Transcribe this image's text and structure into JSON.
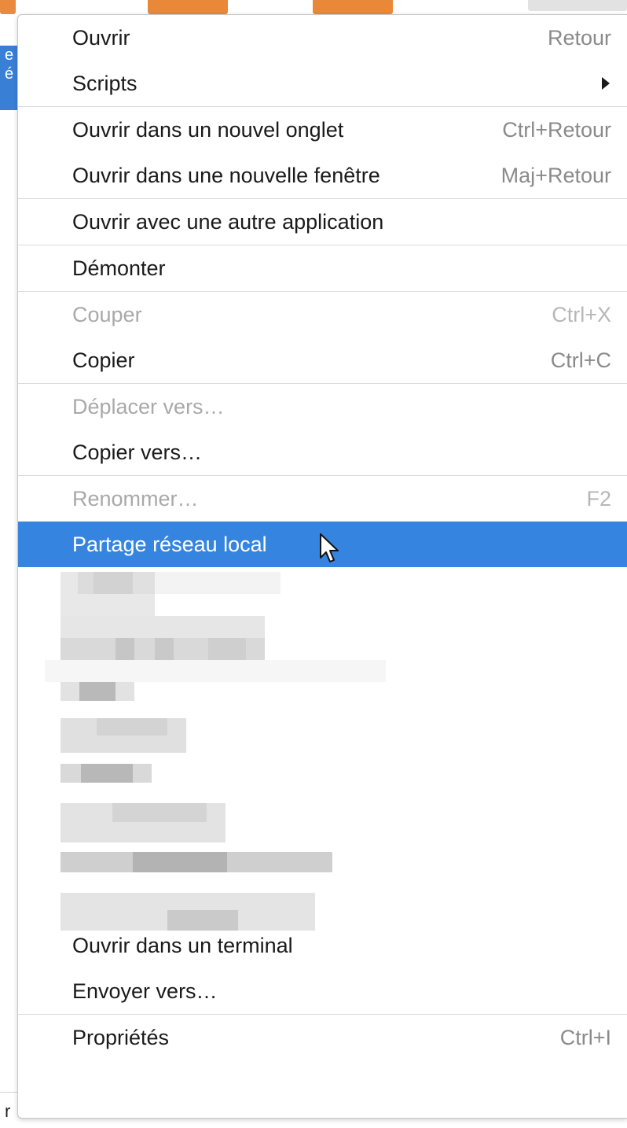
{
  "menu": {
    "sections": [
      {
        "items": [
          {
            "label": "Ouvrir",
            "shortcut": "Retour"
          },
          {
            "label": "Scripts",
            "submenu": true
          }
        ]
      },
      {
        "items": [
          {
            "label": "Ouvrir dans un nouvel onglet",
            "shortcut": "Ctrl+Retour"
          },
          {
            "label": "Ouvrir dans une nouvelle fenêtre",
            "shortcut": "Maj+Retour"
          }
        ]
      },
      {
        "items": [
          {
            "label": "Ouvrir avec une autre application"
          }
        ]
      },
      {
        "items": [
          {
            "label": "Démonter"
          }
        ]
      },
      {
        "items": [
          {
            "label": "Couper",
            "shortcut": "Ctrl+X",
            "disabled": true
          },
          {
            "label": "Copier",
            "shortcut": "Ctrl+C"
          }
        ]
      },
      {
        "items": [
          {
            "label": "Déplacer vers…",
            "disabled": true
          },
          {
            "label": "Copier vers…"
          }
        ]
      },
      {
        "items": [
          {
            "label": "Renommer…",
            "shortcut": "F2",
            "disabled": true
          },
          {
            "label": "Partage réseau local",
            "highlighted": true
          }
        ]
      },
      {
        "items": [
          {
            "label": "Ouvrir dans un terminal"
          },
          {
            "label": "Envoyer vers…"
          }
        ]
      },
      {
        "items": [
          {
            "label": "Propriétés",
            "shortcut": "Ctrl+I"
          }
        ]
      }
    ]
  },
  "background": {
    "left_fragment_text": "e\né",
    "bottom_fragment_text": "r"
  },
  "colors": {
    "highlight": "#3585e0",
    "disabled_text": "#a9a9a9",
    "shortcut_text": "#8a8a8a"
  },
  "icons": {
    "submenu": "triangle-right",
    "cursor": "mouse-pointer"
  }
}
